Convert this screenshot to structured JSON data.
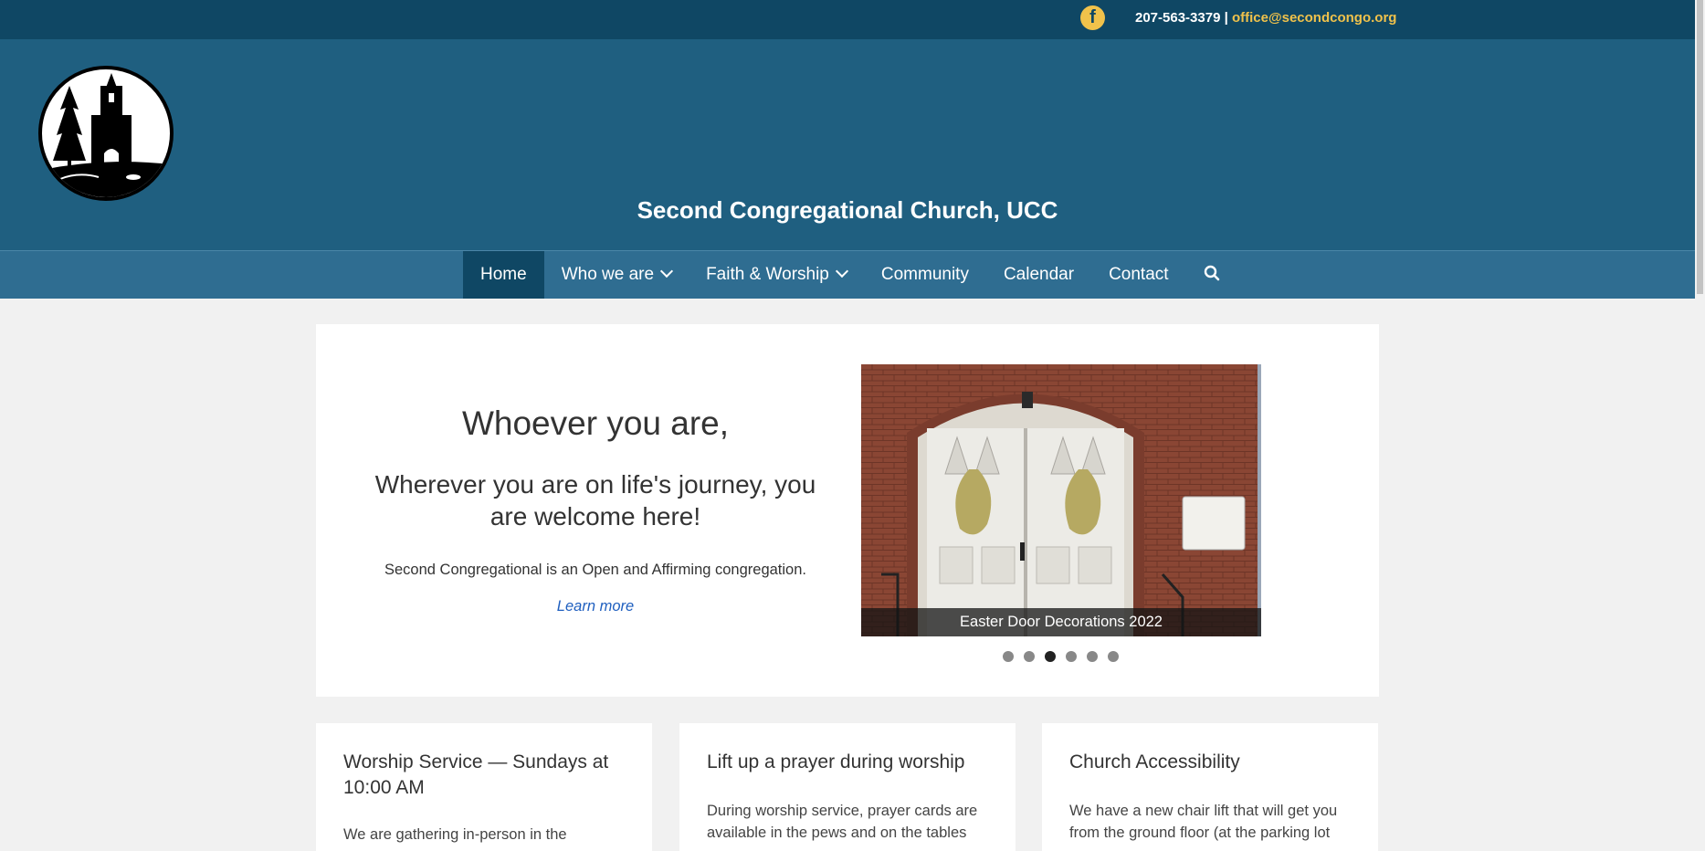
{
  "topbar": {
    "facebook_icon": "facebook-icon",
    "phone": "207-563-3379",
    "separator": " | ",
    "email": "office@secondcongo.org"
  },
  "site": {
    "title": "Second Congregational Church, UCC",
    "logo": "church-logo"
  },
  "nav": {
    "items": [
      {
        "label": "Home",
        "active": true
      },
      {
        "label": "Who we are",
        "dropdown": true
      },
      {
        "label": "Faith & Worship",
        "dropdown": true
      },
      {
        "label": "Community"
      },
      {
        "label": "Calendar"
      },
      {
        "label": "Contact"
      }
    ],
    "search_icon": "search-icon"
  },
  "hero": {
    "heading": "Whoever you are,",
    "subheading": "Wherever you are on life's journey, you are welcome here!",
    "text": "Second Congregational is an Open and Affirming congregation.",
    "link": "Learn more",
    "slide_caption": "Easter Door Decorations 2022",
    "slide_count": 6,
    "active_slide": 3
  },
  "cards": [
    {
      "title": "Worship Service — Sundays at 10:00 AM",
      "text": "We are gathering in-person in the"
    },
    {
      "title": "Lift up a prayer during worship",
      "text": "During worship service, prayer cards are available in the pews and on the tables"
    },
    {
      "title": "Church Accessibility",
      "text": "We have a new chair lift that will get you from the ground floor (at the parking lot"
    }
  ],
  "colors": {
    "topbar": "#0f4764",
    "header": "#1f5f80",
    "nav": "#2f6d91",
    "accent": "#f0c24b"
  }
}
